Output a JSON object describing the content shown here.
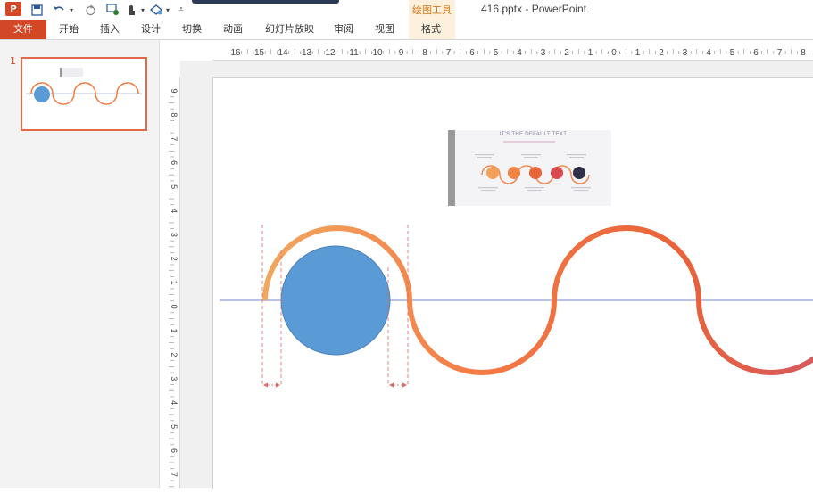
{
  "titlebar": {
    "app_glyph": "P",
    "document_title": "416.pptx - PowerPoint",
    "quick_access": [
      "save-icon",
      "undo-icon",
      "redo-icon",
      "presenter-icon",
      "touch-mode-icon",
      "shapes-icon",
      "customize-icon"
    ]
  },
  "ribbon": {
    "file_tab": "文件",
    "tabs": [
      "开始",
      "插入",
      "设计",
      "切换",
      "动画",
      "幻灯片放映",
      "审阅",
      "视图"
    ],
    "context_group_title": "绘图工具",
    "context_tab": "格式"
  },
  "thumbnails": {
    "slide_number": "1"
  },
  "ruler": {
    "horizontal_labels": [
      "16",
      "15",
      "14",
      "13",
      "12",
      "11",
      "10",
      "9",
      "8",
      "7",
      "6",
      "5",
      "4",
      "3",
      "2",
      "1",
      "0",
      "1",
      "2",
      "3",
      "4",
      "5",
      "6",
      "7",
      "8"
    ],
    "vertical_labels": [
      "9",
      "8",
      "7",
      "6",
      "5",
      "4",
      "3",
      "2",
      "1",
      "0",
      "1",
      "2",
      "3",
      "4",
      "5",
      "6",
      "7"
    ]
  },
  "slide": {
    "picture_title": "IT'S THE DEFAULT TEXT",
    "picture_icons": [
      "shirt-icon",
      "dress-icon",
      "fish-icon",
      "phone-icon",
      "bag-icon"
    ]
  },
  "colors": {
    "accent": "#d24726",
    "wave_start": "#f0a860",
    "wave_mid": "#f47a45",
    "wave_end": "#d75a5e",
    "circle_fill": "#5b9bd5",
    "context_tab": "#d87a1a"
  }
}
